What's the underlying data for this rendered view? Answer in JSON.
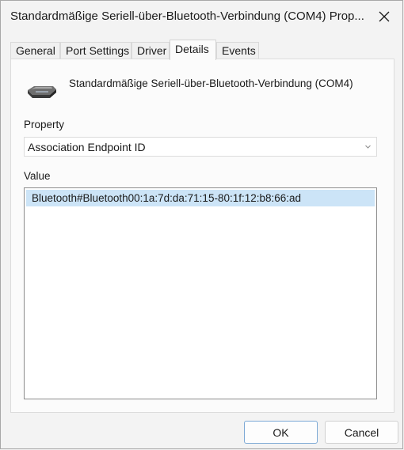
{
  "window": {
    "title": "Standardmäßige Seriell-über-Bluetooth-Verbindung (COM4) Prop...",
    "close_icon": "close-icon"
  },
  "tabs": [
    {
      "label": "General"
    },
    {
      "label": "Port Settings"
    },
    {
      "label": "Driver"
    },
    {
      "label": "Details",
      "active": true
    },
    {
      "label": "Events"
    }
  ],
  "device": {
    "icon": "serial-port-device-icon",
    "name": "Standardmäßige Seriell-über-Bluetooth-Verbindung (COM4)"
  },
  "property": {
    "label": "Property",
    "selected": "Association Endpoint ID"
  },
  "value": {
    "label": "Value",
    "items": [
      "Bluetooth#Bluetooth00:1a:7d:da:71:15-80:1f:12:b8:66:ad"
    ]
  },
  "buttons": {
    "ok": "OK",
    "cancel": "Cancel"
  },
  "colors": {
    "selection": "#cce4f7",
    "default_button_border": "#7aa7d4"
  }
}
